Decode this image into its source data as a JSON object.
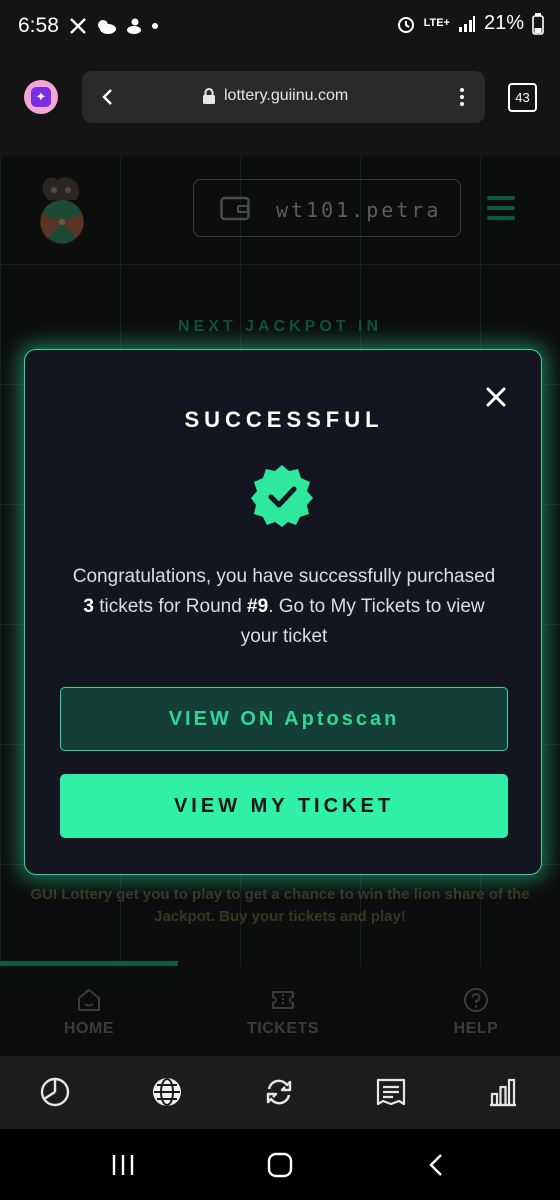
{
  "status_bar": {
    "time": "6:58",
    "left_icons": [
      "x-icon",
      "weather-icon",
      "duck-icon",
      "dot-icon"
    ],
    "battery": "21%",
    "network": "LTE+"
  },
  "browser": {
    "url": "lottery.guiinu.com",
    "tab_count": "43"
  },
  "page": {
    "wallet_name": "wt101.petra",
    "jackpot_label": "NEXT JACKPOT IN",
    "intro": "GUI Lottery get you to play to get a chance to win the lion share of the Jackpot. Buy your tickets and play!",
    "nav": [
      {
        "label": "HOME",
        "icon": "home-icon"
      },
      {
        "label": "TICKETS",
        "icon": "ticket-icon"
      },
      {
        "label": "HELP",
        "icon": "help-icon"
      }
    ]
  },
  "modal": {
    "title": "SUCCESSFUL",
    "msg_part1": "Congratulations, you have successfully purchased ",
    "ticket_count": "3",
    "msg_part2": " tickets for Round ",
    "round": "#9",
    "msg_part3": ". Go to My Tickets to view your ticket",
    "aptoscan_label": "VIEW ON Aptoscan",
    "my_ticket_label": "VIEW MY TICKET"
  },
  "toolbar": {
    "icons": [
      "pie-chart-icon",
      "globe-icon",
      "refresh-icon",
      "news-icon",
      "bar-chart-icon"
    ]
  },
  "colors": {
    "accent": "#2ff0a6",
    "modal_bg": "#131521",
    "page_bg": "#0c0d0d"
  }
}
